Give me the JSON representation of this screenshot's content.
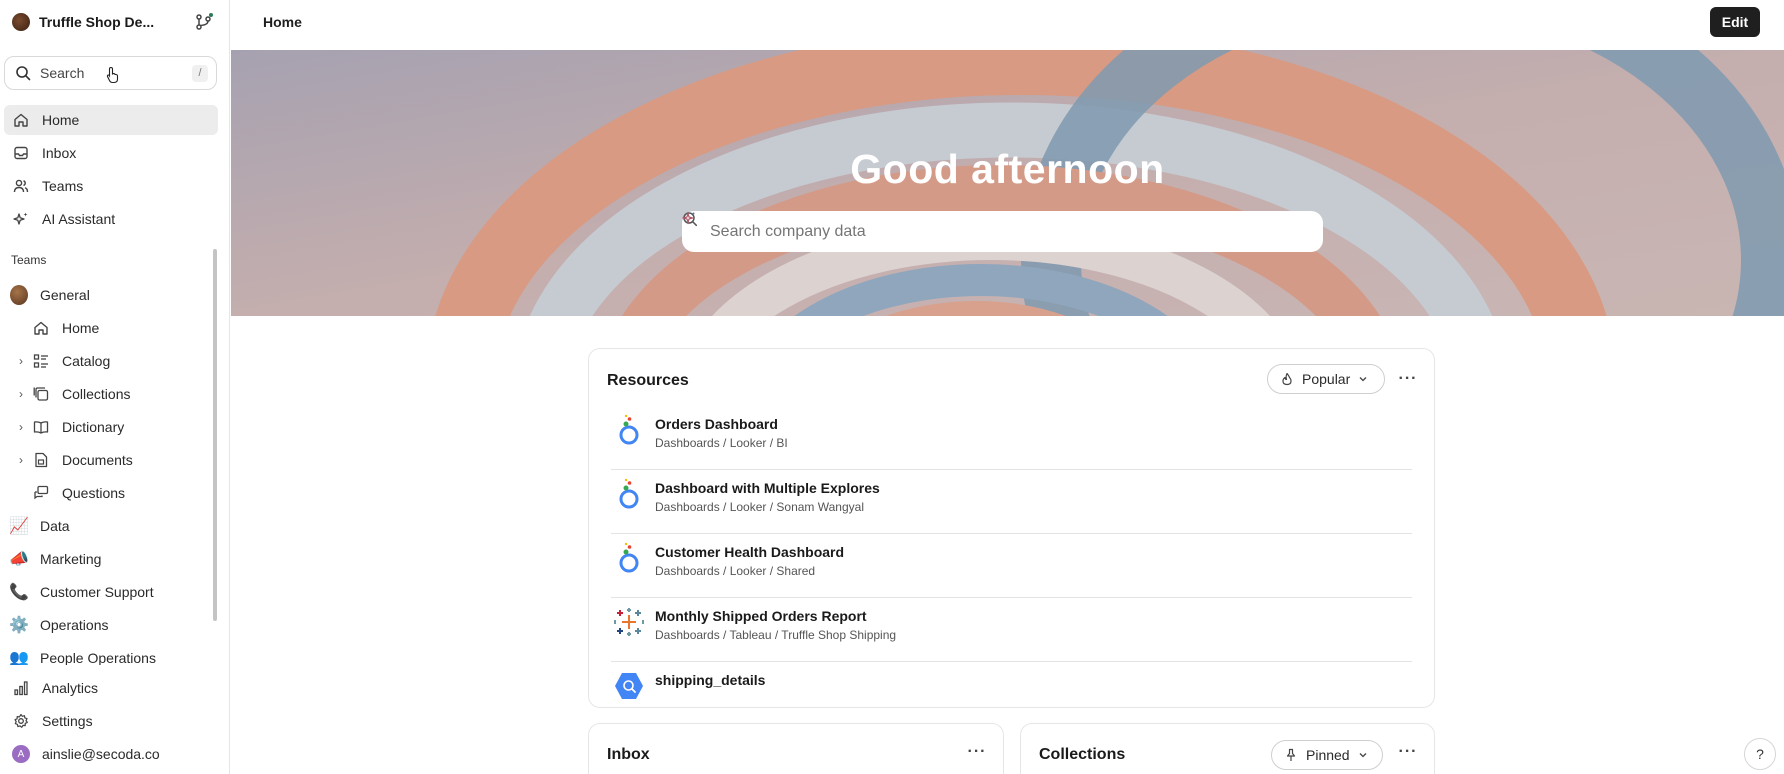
{
  "workspace": {
    "name": "Truffle Shop De..."
  },
  "search": {
    "label": "Search",
    "shortcut": "/"
  },
  "nav": {
    "main": [
      {
        "label": "Home",
        "icon": "home-icon"
      },
      {
        "label": "Inbox",
        "icon": "inbox-icon"
      },
      {
        "label": "Teams",
        "icon": "users-icon"
      },
      {
        "label": "AI Assistant",
        "icon": "sparkles-icon"
      }
    ],
    "teams_label": "Teams",
    "teams": {
      "general": {
        "label": "General"
      },
      "general_children": [
        {
          "label": "Home"
        },
        {
          "label": "Catalog"
        },
        {
          "label": "Collections"
        },
        {
          "label": "Dictionary"
        },
        {
          "label": "Documents"
        },
        {
          "label": "Questions"
        }
      ],
      "others": [
        {
          "label": "Data",
          "emoji": "📈"
        },
        {
          "label": "Marketing",
          "emoji": "📣"
        },
        {
          "label": "Customer Support",
          "emoji": "📞"
        },
        {
          "label": "Operations",
          "emoji": "⚙️"
        },
        {
          "label": "People Operations",
          "emoji": "👥"
        }
      ]
    },
    "bottom": [
      {
        "label": "Analytics"
      },
      {
        "label": "Settings"
      }
    ],
    "user": {
      "email": "ainslie@secoda.co",
      "initial": "A"
    }
  },
  "topbar": {
    "title": "Home",
    "edit_label": "Edit"
  },
  "hero": {
    "greeting": "Good afternoon",
    "search_placeholder": "Search company data"
  },
  "resources": {
    "title": "Resources",
    "filter": "Popular",
    "items": [
      {
        "title": "Orders Dashboard",
        "path": "Dashboards / Looker / BI",
        "source": "looker"
      },
      {
        "title": "Dashboard with Multiple Explores",
        "path": "Dashboards / Looker / Sonam Wangyal",
        "source": "looker"
      },
      {
        "title": "Customer Health Dashboard",
        "path": "Dashboards / Looker / Shared",
        "source": "looker"
      },
      {
        "title": "Monthly Shipped Orders Report",
        "path": "Dashboards / Tableau / Truffle Shop Shipping",
        "source": "tableau"
      },
      {
        "title": "shipping_details",
        "path": "",
        "source": "bigquery"
      }
    ]
  },
  "inbox_card": {
    "title": "Inbox"
  },
  "collections_card": {
    "title": "Collections",
    "filter": "Pinned"
  },
  "help": {
    "label": "?"
  }
}
